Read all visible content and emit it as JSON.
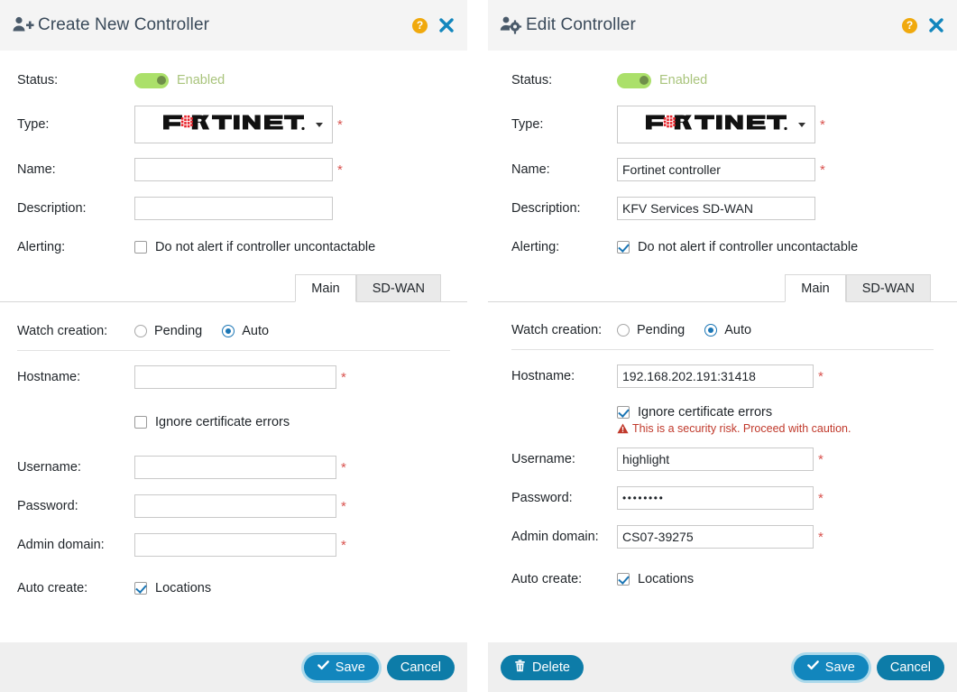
{
  "panels": {
    "create": {
      "title": "Create New Controller",
      "header_icon": "user-add-icon",
      "help_label": "?",
      "close_label": "✖",
      "labels": {
        "status": "Status:",
        "type": "Type:",
        "name": "Name:",
        "description": "Description:",
        "alerting": "Alerting:",
        "watch_creation": "Watch creation:",
        "hostname": "Hostname:",
        "username": "Username:",
        "password": "Password:",
        "admin_domain": "Admin domain:",
        "auto_create": "Auto create:"
      },
      "status": {
        "enabled": true,
        "text": "Enabled"
      },
      "type": {
        "value": "FORTINET",
        "logo": "fortinet-logo"
      },
      "name": {
        "value": "",
        "placeholder": ""
      },
      "description": {
        "value": "",
        "placeholder": ""
      },
      "alerting": {
        "checked": false,
        "label": "Do not alert if controller uncontactable"
      },
      "tabs": [
        {
          "label": "Main",
          "active": true
        },
        {
          "label": "SD-WAN",
          "active": false
        }
      ],
      "watch_creation": {
        "options": [
          {
            "label": "Pending",
            "selected": false
          },
          {
            "label": "Auto",
            "selected": true
          }
        ]
      },
      "hostname": {
        "value": "",
        "placeholder": ""
      },
      "ignore_cert": {
        "checked": false,
        "label": "Ignore certificate errors",
        "warning": ""
      },
      "username": {
        "value": "",
        "placeholder": ""
      },
      "password": {
        "value": "",
        "placeholder": ""
      },
      "admin_domain": {
        "value": "",
        "placeholder": ""
      },
      "auto_create": {
        "checked": true,
        "label": "Locations"
      },
      "buttons": {
        "save": "Save",
        "cancel": "Cancel"
      }
    },
    "edit": {
      "title": "Edit Controller",
      "header_icon": "user-gear-icon",
      "help_label": "?",
      "close_label": "✖",
      "labels": {
        "status": "Status:",
        "type": "Type:",
        "name": "Name:",
        "description": "Description:",
        "alerting": "Alerting:",
        "watch_creation": "Watch creation:",
        "hostname": "Hostname:",
        "username": "Username:",
        "password": "Password:",
        "admin_domain": "Admin domain:",
        "auto_create": "Auto create:"
      },
      "status": {
        "enabled": true,
        "text": "Enabled"
      },
      "type": {
        "value": "FORTINET",
        "logo": "fortinet-logo"
      },
      "name": {
        "value": "Fortinet controller",
        "placeholder": ""
      },
      "description": {
        "value": "KFV Services SD-WAN",
        "placeholder": ""
      },
      "alerting": {
        "checked": true,
        "label": "Do not alert if controller uncontactable"
      },
      "tabs": [
        {
          "label": "Main",
          "active": true
        },
        {
          "label": "SD-WAN",
          "active": false
        }
      ],
      "watch_creation": {
        "options": [
          {
            "label": "Pending",
            "selected": false
          },
          {
            "label": "Auto",
            "selected": true
          }
        ]
      },
      "hostname": {
        "value": "192.168.202.191:31418",
        "placeholder": ""
      },
      "ignore_cert": {
        "checked": true,
        "label": "Ignore certificate errors",
        "warning": "This is a security risk. Proceed with caution."
      },
      "username": {
        "value": "highlight",
        "placeholder": ""
      },
      "password": {
        "value": "••••••••",
        "placeholder": ""
      },
      "admin_domain": {
        "value": "CS07-39275",
        "placeholder": ""
      },
      "auto_create": {
        "checked": true,
        "label": "Locations"
      },
      "buttons": {
        "delete": "Delete",
        "save": "Save",
        "cancel": "Cancel"
      }
    }
  },
  "colors": {
    "accent_blue": "#1286bd",
    "dark_blue": "#0d7ca8",
    "toggle_green": "#abe06a",
    "required_red": "#d9534f",
    "warning_red": "#c0392b",
    "help_amber": "#f0a90d",
    "header_bg": "#f4f4f4",
    "footer_bg": "#efefef"
  }
}
